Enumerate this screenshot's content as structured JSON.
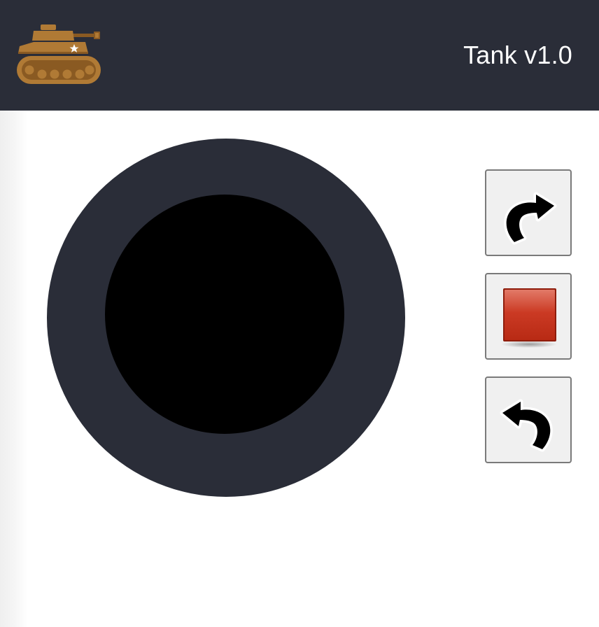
{
  "app": {
    "title": "Tank v1.0",
    "logo_icon": "tank-icon"
  },
  "colors": {
    "header_bg": "#2a2d38",
    "joystick_ring": "#2a2d38",
    "joystick_knob": "#000000",
    "stop_red": "#c0301c",
    "tank_brown": "#b07a35",
    "button_bg": "#f0f0f0"
  },
  "controls": {
    "turn_right": {
      "icon": "rotate-right-arrow-icon"
    },
    "stop": {
      "icon": "stop-square-icon"
    },
    "turn_left": {
      "icon": "rotate-left-arrow-icon"
    }
  }
}
